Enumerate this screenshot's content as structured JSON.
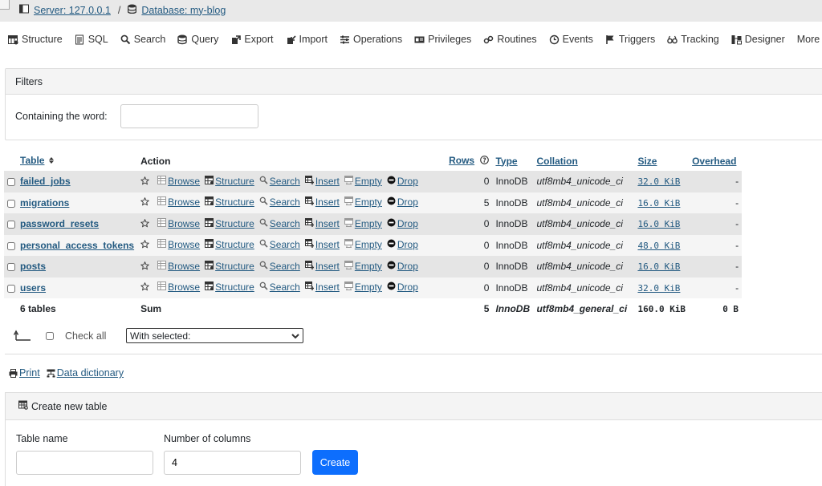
{
  "breadcrumb": {
    "server": "Server: 127.0.0.1",
    "separator": "/",
    "database": "Database: my-blog"
  },
  "topmenu": [
    "Structure",
    "SQL",
    "Search",
    "Query",
    "Export",
    "Import",
    "Operations",
    "Privileges",
    "Routines",
    "Events",
    "Triggers",
    "Tracking",
    "Designer",
    "More"
  ],
  "filters": {
    "title": "Filters",
    "label": "Containing the word:",
    "value": ""
  },
  "table": {
    "headers": {
      "table": "Table",
      "action": "Action",
      "rows": "Rows",
      "type": "Type",
      "collation": "Collation",
      "size": "Size",
      "overhead": "Overhead"
    },
    "actions": {
      "browse": "Browse",
      "structure": "Structure",
      "search": "Search",
      "insert": "Insert",
      "empty": "Empty",
      "drop": "Drop"
    },
    "rows": [
      {
        "name": "failed_jobs",
        "rows": "0",
        "type": "InnoDB",
        "collation": "utf8mb4_unicode_ci",
        "size": "32.0 KiB",
        "overhead": "-"
      },
      {
        "name": "migrations",
        "rows": "5",
        "type": "InnoDB",
        "collation": "utf8mb4_unicode_ci",
        "size": "16.0 KiB",
        "overhead": "-"
      },
      {
        "name": "password_resets",
        "rows": "0",
        "type": "InnoDB",
        "collation": "utf8mb4_unicode_ci",
        "size": "16.0 KiB",
        "overhead": "-"
      },
      {
        "name": "personal_access_tokens",
        "rows": "0",
        "type": "InnoDB",
        "collation": "utf8mb4_unicode_ci",
        "size": "48.0 KiB",
        "overhead": "-"
      },
      {
        "name": "posts",
        "rows": "0",
        "type": "InnoDB",
        "collation": "utf8mb4_unicode_ci",
        "size": "16.0 KiB",
        "overhead": "-"
      },
      {
        "name": "users",
        "rows": "0",
        "type": "InnoDB",
        "collation": "utf8mb4_unicode_ci",
        "size": "32.0 KiB",
        "overhead": "-"
      }
    ],
    "footer": {
      "count": "6 tables",
      "sum": "Sum",
      "rows": "5",
      "type": "InnoDB",
      "collation": "utf8mb4_general_ci",
      "size": "160.0 KiB",
      "overhead": "0 B"
    }
  },
  "bulk": {
    "check_all": "Check all",
    "with_selected": "With selected:"
  },
  "links": {
    "print": "Print",
    "data_dictionary": "Data dictionary"
  },
  "create": {
    "title": "Create new table",
    "name_label": "Table name",
    "name_value": "",
    "cols_label": "Number of columns",
    "cols_value": "4",
    "button": "Create"
  },
  "colors": {
    "link": "#235a81",
    "primary": "#0d6efd",
    "row_odd": "#e5e5e5",
    "row_even": "#f5f5f5"
  }
}
